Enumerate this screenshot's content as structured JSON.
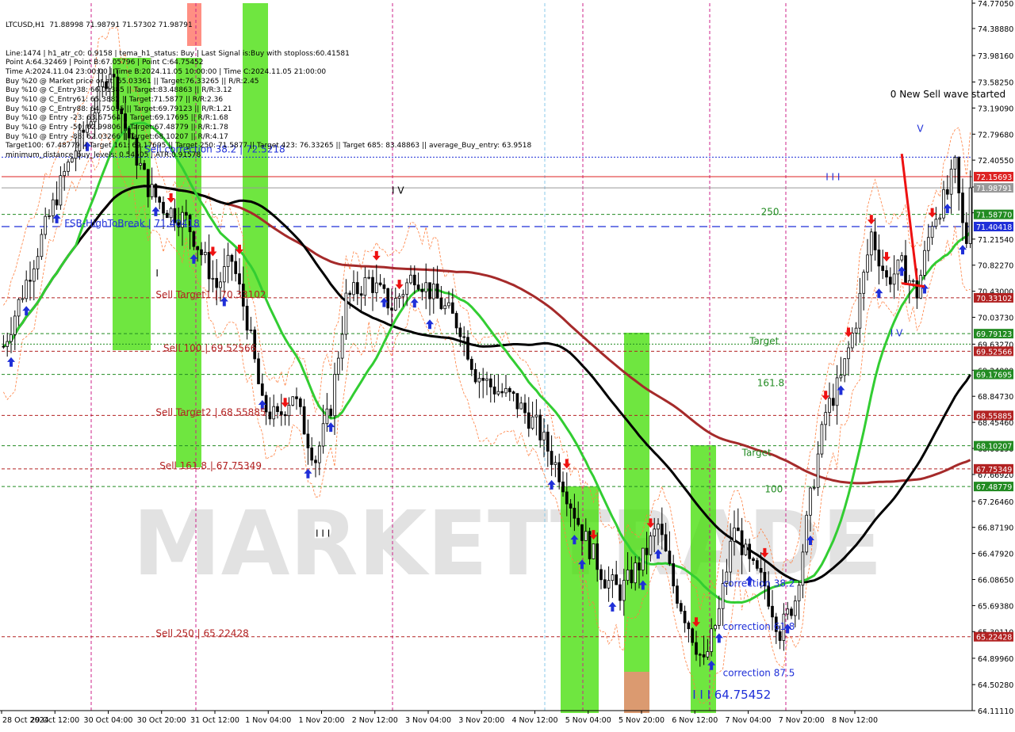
{
  "chart_data": {
    "type": "candlestick",
    "symbol_header": "LTCUSD,H1  71.88998 71.98791 71.57302 71.98791",
    "info_lines": [
      "Line:1474 | h1_atr_c0: 0.9158 | tema_h1_status: Buy | Last Signal is:Buy with stoploss:60.41581",
      "Point A:64.32469 | Point B:67.05796 | Point C:64.75452",
      "Time A:2024.11.04 23:00:00 | Time B:2024.11.05 10:00:00 | Time C:2024.11.05 21:00:00",
      "Buy %20 @ Market price or at: 65.03361 || Target:76.33265 || R/R:2.45",
      "Buy %10 @ C_Entry38: 66.01385 || Target:83.48863 || R/R:3.12",
      "Buy %10 @ C_Entry61: 65.3882 || Target:71.5877 || R/R:2.36",
      "Buy %10 @ C_Entry88: 64.75035 || Target:69.79123 || R/R:1.21",
      "Buy %10 @ Entry -23: 63.67564 || Target:69.17695 || R/R:1.68",
      "Buy %10 @ Entry -50: 62.99806 || Target:67.48779 || R/R:1.78",
      "Buy %10 @ Entry -88: 62.03266 || Target:68.10207 || R/R:4.17",
      "Target100: 67.48779 || Target 161: 69.17695 || Target 250: 71.5877 || Target 423: 76.33265 || Target 685: 83.48863 || average_Buy_entry: 63.9518",
      "minimum_distance_buy_levels: 0.54505 | ATR:0.91578"
    ],
    "y_axis": {
      "min": 64.1111,
      "max": 74.7705,
      "ticks": [
        "74.77050",
        "74.38880",
        "73.98160",
        "73.58250",
        "73.19090",
        "72.79680",
        "72.40550",
        "72.00000",
        "71.61190",
        "71.21540",
        "70.82270",
        "70.43000",
        "70.03730",
        "69.63270",
        "69.24000",
        "68.84730",
        "68.45460",
        "68.06190",
        "67.66920",
        "67.26460",
        "66.87190",
        "66.47920",
        "66.08650",
        "65.69380",
        "65.30110",
        "64.89960",
        "64.50280",
        "64.11110"
      ]
    },
    "x_axis": {
      "ticks": [
        "28 Oct 2024",
        "29 Oct 12:00",
        "30 Oct 04:00",
        "30 Oct 20:00",
        "31 Oct 12:00",
        "1 Nov 04:00",
        "1 Nov 20:00",
        "2 Nov 12:00",
        "3 Nov 04:00",
        "3 Nov 20:00",
        "4 Nov 12:00",
        "5 Nov 04:00",
        "5 Nov 20:00",
        "6 Nov 12:00",
        "7 Nov 04:00",
        "7 Nov 20:00",
        "8 Nov 12:00"
      ],
      "n_bars": 255
    },
    "price_levels": [
      {
        "value": 72.15693,
        "label": "72.15693",
        "color": "#dd2222",
        "style": "solid"
      },
      {
        "value": 71.98791,
        "label": "71.98791",
        "color": "#999999",
        "style": "solid",
        "current": true
      },
      {
        "value": 71.5877,
        "label": "71.58770",
        "color": "#228b22",
        "style": "dash"
      },
      {
        "value": 71.40418,
        "label": "71.40418",
        "color": "#1f2fd8",
        "style": "dash"
      },
      {
        "value": 70.33102,
        "label": "70.33102",
        "color": "#b22222",
        "style": "dash"
      },
      {
        "value": 69.79123,
        "label": "69.79123",
        "color": "#228b22",
        "style": "dash"
      },
      {
        "value": 69.52566,
        "label": "69.52566",
        "color": "#b22222",
        "style": "dash"
      },
      {
        "value": 69.17695,
        "label": "69.17695",
        "color": "#228b22",
        "style": "dash"
      },
      {
        "value": 68.55885,
        "label": "68.55885",
        "color": "#b22222",
        "style": "dash"
      },
      {
        "value": 68.10207,
        "label": "68.10207",
        "color": "#228b22",
        "style": "dash"
      },
      {
        "value": 67.75349,
        "label": "67.75349",
        "color": "#b22222",
        "style": "dash"
      },
      {
        "value": 67.48779,
        "label": "67.48779",
        "color": "#228b22",
        "style": "dash"
      },
      {
        "value": 65.22428,
        "label": "65.22428",
        "color": "#b22222",
        "style": "dash"
      }
    ],
    "extra_lines": [
      {
        "value": 72.4502,
        "color": "#1f2fd8",
        "style": "dot"
      },
      {
        "value": 69.6327,
        "color": "#228b22",
        "style": "dot"
      }
    ],
    "chart_labels": [
      {
        "text": "Sell Target1 | 70.33102",
        "bar": 40,
        "value": 70.33102,
        "color": "#b22222"
      },
      {
        "text": "Sell 100 | 69.52566",
        "bar": 42,
        "value": 69.52566,
        "color": "#b22222"
      },
      {
        "text": "Sell Target2 | 68.55885",
        "bar": 40,
        "value": 68.55885,
        "color": "#b22222"
      },
      {
        "text": "Sell 161.8 | 67.75349",
        "bar": 41,
        "value": 67.75349,
        "color": "#b22222"
      },
      {
        "text": "Sell 250 | 65.22428",
        "bar": 40,
        "value": 65.22428,
        "color": "#b22222"
      },
      {
        "text": "Sell correction 38.2 | 72.5218",
        "bar": 37,
        "value": 72.5218,
        "color": "#1f2fd8"
      },
      {
        "text": "FSB-HighToBreak | 71.40418",
        "bar": 16,
        "value": 71.40418,
        "color": "#1f2fd8"
      },
      {
        "text": "0 New Sell wave started",
        "bar": 233,
        "value": 73.35,
        "color": "#000000"
      },
      {
        "text": "250",
        "bar": 199,
        "value": 71.58,
        "color": "#228b22"
      },
      {
        "text": "Target",
        "bar": 196,
        "value": 69.63,
        "color": "#228b22"
      },
      {
        "text": "161.8",
        "bar": 198,
        "value": 69.0,
        "color": "#228b22"
      },
      {
        "text": "Target",
        "bar": 194,
        "value": 67.95,
        "color": "#228b22"
      },
      {
        "text": "100",
        "bar": 200,
        "value": 67.4,
        "color": "#228b22"
      },
      {
        "text": "correction 38.2",
        "bar": 189,
        "value": 65.98,
        "color": "#1f2fd8"
      },
      {
        "text": "correction 61.8",
        "bar": 189,
        "value": 65.33,
        "color": "#1f2fd8"
      },
      {
        "text": "correction 87.5",
        "bar": 189,
        "value": 64.63,
        "color": "#1f2fd8"
      },
      {
        "text": "I I I  64.75452",
        "bar": 181,
        "value": 64.29,
        "color": "#1f2fd8",
        "big": true
      },
      {
        "text": "I V",
        "bar": 102,
        "value": 71.9,
        "color": "#000000"
      },
      {
        "text": "I I I",
        "bar": 82,
        "value": 66.73,
        "color": "#000000"
      },
      {
        "text": "I",
        "bar": 40,
        "value": 70.65,
        "color": "#000000"
      },
      {
        "text": "I I I",
        "bar": 216,
        "value": 72.1,
        "color": "#1f2fd8"
      },
      {
        "text": "V",
        "bar": 240,
        "value": 72.83,
        "color": "#1f2fd8"
      },
      {
        "text": "I V",
        "bar": 233,
        "value": 69.75,
        "color": "#1f2fd8"
      }
    ],
    "watermark": "MARKETTRADE"
  }
}
